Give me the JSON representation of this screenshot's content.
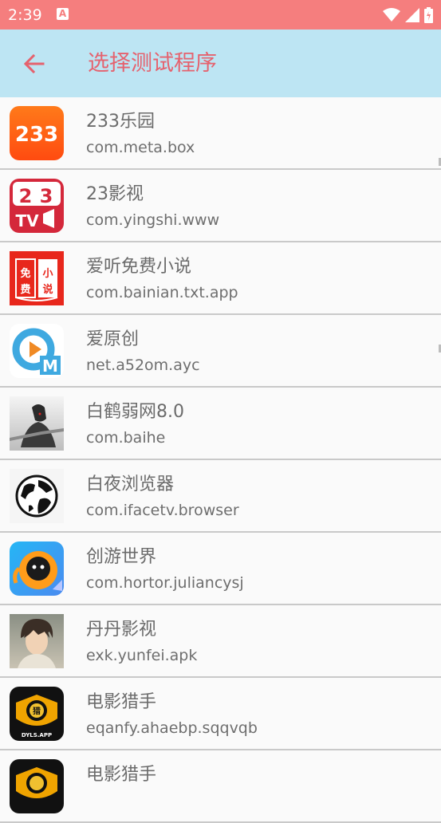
{
  "status_bar": {
    "time": "2:39",
    "notification_icon": "a-icon",
    "icons": [
      "wifi-icon",
      "cell-signal-icon",
      "battery-icon"
    ]
  },
  "app_bar": {
    "back_icon": "arrow-left-icon",
    "title": "选择测试程序"
  },
  "apps": [
    {
      "name": "233乐园",
      "package": "com.meta.box",
      "icon": "233-icon"
    },
    {
      "name": "23影视",
      "package": "com.yingshi.www",
      "icon": "23tv-icon"
    },
    {
      "name": "爱听免费小说",
      "package": "com.bainian.txt.app",
      "icon": "novel-icon"
    },
    {
      "name": "爱原创",
      "package": "net.a52om.ayc",
      "icon": "play-m-icon"
    },
    {
      "name": "白鹤弱网8.0",
      "package": "com.baihe",
      "icon": "character-icon"
    },
    {
      "name": "白夜浏览器",
      "package": "com.ifacetv.browser",
      "icon": "globe-icon"
    },
    {
      "name": "创游世界",
      "package": "com.hortor.juliancysj",
      "icon": "creature-icon"
    },
    {
      "name": "丹丹影视",
      "package": "exk.yunfei.apk",
      "icon": "anime-boy-icon"
    },
    {
      "name": "电影猎手",
      "package": "eqanfy.ahaebp.sqqvqb",
      "icon": "movie-hunter-icon"
    },
    {
      "name": "电影猎手",
      "package": "",
      "icon": "movie-hunter-icon"
    }
  ],
  "colors": {
    "status_bar": "#f57e7e",
    "app_bar": "#bde5f3",
    "accent": "#e5626e",
    "background": "#fafafa"
  }
}
